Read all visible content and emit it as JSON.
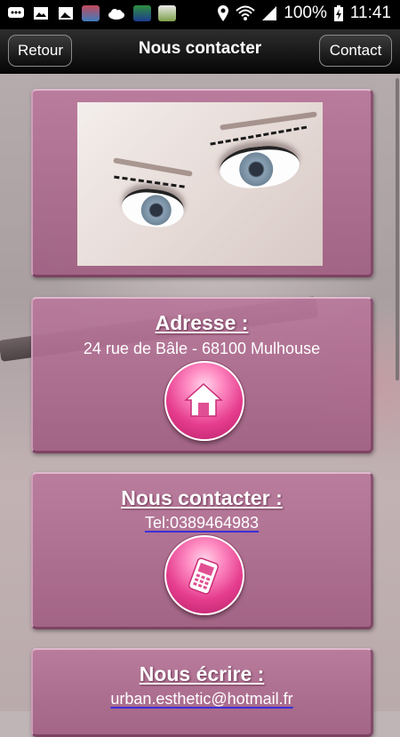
{
  "status_bar": {
    "battery": "100%",
    "time": "11:41"
  },
  "header": {
    "back_label": "Retour",
    "title": "Nous contacter",
    "contact_label": "Contact"
  },
  "address": {
    "heading": "Adresse :",
    "text": "24 rue de Bâle - 68100 Mulhouse"
  },
  "phone": {
    "heading": "Nous contacter :",
    "link": "Tel:0389464983"
  },
  "email": {
    "heading": "Nous écrire :",
    "link": "urban.esthetic@hotmail.fr"
  },
  "colors": {
    "card": "#b0709a",
    "button": "#e63d8f",
    "header": "#000000"
  }
}
